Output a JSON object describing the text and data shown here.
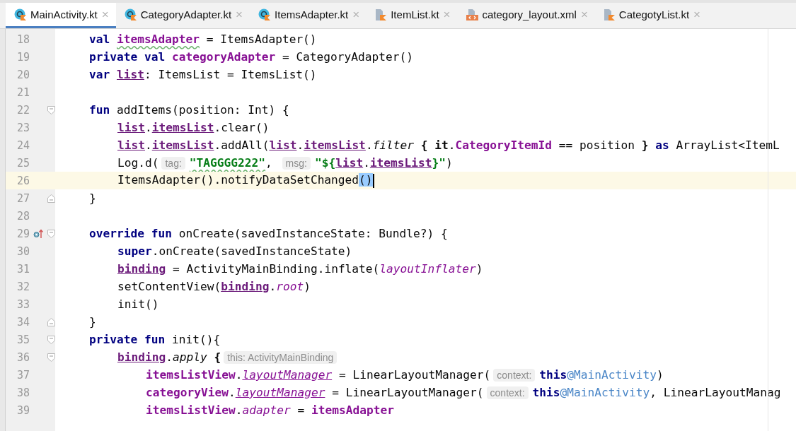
{
  "tabs": [
    {
      "label": "MainActivity.kt",
      "kind": "class",
      "selected": true
    },
    {
      "label": "CategoryAdapter.kt",
      "kind": "class",
      "selected": false
    },
    {
      "label": "ItemsAdapter.kt",
      "kind": "class",
      "selected": false
    },
    {
      "label": "ItemList.kt",
      "kind": "file",
      "selected": false
    },
    {
      "label": "category_layout.xml",
      "kind": "xml",
      "selected": false
    },
    {
      "label": "CategotyList.kt",
      "kind": "file",
      "selected": false
    }
  ],
  "close_glyph": "×",
  "editor": {
    "lines": [
      {
        "number": "18",
        "current": false,
        "tokens": [
          {
            "text": "val ",
            "kind": "kw"
          },
          {
            "text": "itemsAdapter",
            "kind": "field",
            "typo": true
          },
          {
            "text": " = ItemsAdapter()",
            "kind": "plain"
          }
        ]
      },
      {
        "number": "19",
        "current": false,
        "tokens": [
          {
            "text": "private val ",
            "kind": "kw"
          },
          {
            "text": "categoryAdapter",
            "kind": "field"
          },
          {
            "text": " = CategoryAdapter()",
            "kind": "plain"
          }
        ]
      },
      {
        "number": "20",
        "current": false,
        "tokens": [
          {
            "text": "var ",
            "kind": "kw"
          },
          {
            "text": "list",
            "kind": "field_ul"
          },
          {
            "text": ": ItemsList = ItemsList()",
            "kind": "plain"
          }
        ]
      },
      {
        "number": "21",
        "current": false
      },
      {
        "number": "22",
        "current": false,
        "fold_start": true,
        "tokens": [
          {
            "text": "fun ",
            "kind": "kw"
          },
          {
            "text": "addItems(position: Int) {",
            "kind": "plain"
          }
        ],
        "children": [
          {
            "number": "23",
            "current": false,
            "tokens": [
              {
                "text": "list",
                "kind": "field_ul"
              },
              {
                "text": ".",
                "kind": "plain"
              },
              {
                "text": "itemsList",
                "kind": "field_ul"
              },
              {
                "text": ".clear()",
                "kind": "plain"
              }
            ]
          },
          {
            "number": "24",
            "current": false,
            "tokens": [
              {
                "text": "list",
                "kind": "field_ul"
              },
              {
                "text": ".",
                "kind": "plain"
              },
              {
                "text": "itemsList",
                "kind": "field_ul"
              },
              {
                "text": ".addAll(",
                "kind": "plain"
              },
              {
                "text": "list",
                "kind": "field_ul"
              },
              {
                "text": ".",
                "kind": "plain"
              },
              {
                "text": "itemsList",
                "kind": "field_ul"
              },
              {
                "text": ".",
                "kind": "plain"
              },
              {
                "text": "filter",
                "kind": "fn_i"
              },
              {
                "text": " {",
                "kind": "bold"
              },
              {
                "text": " it",
                "kind": "bold"
              },
              {
                "text": ".",
                "kind": "plain"
              },
              {
                "text": "CategoryItemId",
                "kind": "field"
              },
              {
                "text": " == position ",
                "kind": "plain"
              },
              {
                "text": "}",
                "kind": "bold"
              },
              {
                "text": " as",
                "kind": "kw"
              },
              {
                "text": " ArrayList<ItemL",
                "kind": "plain"
              }
            ]
          },
          {
            "number": "25",
            "current": false,
            "tokens": [
              {
                "text": "Log.d(",
                "kind": "plain"
              },
              {
                "text": "tag:",
                "kind": "hint"
              },
              {
                "text": "\"TAGGGG222\"",
                "kind": "str",
                "typo": true
              },
              {
                "text": ", ",
                "kind": "plain"
              },
              {
                "text": "msg:",
                "kind": "hint"
              },
              {
                "text": "\"${",
                "kind": "str"
              },
              {
                "text": "list",
                "kind": "field_ul"
              },
              {
                "text": ".",
                "kind": "plain"
              },
              {
                "text": "itemsList",
                "kind": "field_ul"
              },
              {
                "text": "}\"",
                "kind": "str"
              },
              {
                "text": ")",
                "kind": "plain"
              }
            ]
          },
          {
            "number": "26",
            "current": true,
            "tokens": [
              {
                "text": "ItemsAdapter().notifyDataSetChanged",
                "kind": "plain"
              },
              {
                "text": "()",
                "kind": "match"
              }
            ]
          }
        ]
      },
      {
        "number": "27",
        "current": false,
        "fold_end": true,
        "tokens": [
          {
            "text": "}",
            "kind": "plain"
          }
        ]
      },
      {
        "number": "28",
        "current": false
      },
      {
        "number": "29",
        "current": false,
        "fold_start": true,
        "override": true,
        "tokens": [
          {
            "text": "override fun ",
            "kind": "kw"
          },
          {
            "text": "onCreate(savedInstanceState: Bundle?) {",
            "kind": "plain"
          }
        ],
        "children": [
          {
            "number": "30",
            "current": false,
            "tokens": [
              {
                "text": "super",
                "kind": "kw"
              },
              {
                "text": ".onCreate(savedInstanceState)",
                "kind": "plain"
              }
            ]
          },
          {
            "number": "31",
            "current": false,
            "tokens": [
              {
                "text": "binding",
                "kind": "field_ul"
              },
              {
                "text": " = ActivityMainBinding.inflate(",
                "kind": "plain"
              },
              {
                "text": "layoutInflater",
                "kind": "prop_i"
              },
              {
                "text": ")",
                "kind": "plain"
              }
            ]
          },
          {
            "number": "32",
            "current": false,
            "tokens": [
              {
                "text": "setContentView(",
                "kind": "plain"
              },
              {
                "text": "binding",
                "kind": "field_ul"
              },
              {
                "text": ".",
                "kind": "plain"
              },
              {
                "text": "root",
                "kind": "prop_i"
              },
              {
                "text": ")",
                "kind": "plain"
              }
            ]
          },
          {
            "number": "33",
            "current": false,
            "tokens": [
              {
                "text": "init()",
                "kind": "plain"
              }
            ]
          }
        ]
      },
      {
        "number": "34",
        "current": false,
        "fold_end": true,
        "tokens": [
          {
            "text": "}",
            "kind": "plain"
          }
        ]
      },
      {
        "number": "35",
        "current": false,
        "fold_start": true,
        "tokens": [
          {
            "text": "private fun ",
            "kind": "kw"
          },
          {
            "text": "init(){",
            "kind": "plain"
          }
        ],
        "children": [
          {
            "number": "36",
            "current": false,
            "fold_start": true,
            "tokens": [
              {
                "text": "binding",
                "kind": "field_ul"
              },
              {
                "text": ".",
                "kind": "plain"
              },
              {
                "text": "apply",
                "kind": "fn_i"
              },
              {
                "text": " {",
                "kind": "bold"
              },
              {
                "text": "this: ActivityMainBinding",
                "kind": "hint"
              }
            ],
            "children": [
              {
                "number": "37",
                "current": false,
                "tokens": [
                  {
                    "text": "itemsListView",
                    "kind": "field"
                  },
                  {
                    "text": ".",
                    "kind": "plain"
                  },
                  {
                    "text": "layoutManager",
                    "kind": "prop_i_ul"
                  },
                  {
                    "text": " = LinearLayoutManager(",
                    "kind": "plain"
                  },
                  {
                    "text": "context:",
                    "kind": "hint"
                  },
                  {
                    "text": "this",
                    "kind": "kw"
                  },
                  {
                    "text": "@MainActivity",
                    "kind": "label"
                  },
                  {
                    "text": ")",
                    "kind": "plain"
                  }
                ]
              },
              {
                "number": "38",
                "current": false,
                "tokens": [
                  {
                    "text": "categoryView",
                    "kind": "field"
                  },
                  {
                    "text": ".",
                    "kind": "plain"
                  },
                  {
                    "text": "layoutManager",
                    "kind": "prop_i_ul"
                  },
                  {
                    "text": " = LinearLayoutManager(",
                    "kind": "plain"
                  },
                  {
                    "text": "context:",
                    "kind": "hint"
                  },
                  {
                    "text": "this",
                    "kind": "kw"
                  },
                  {
                    "text": "@MainActivity",
                    "kind": "label"
                  },
                  {
                    "text": ", LinearLayoutManag",
                    "kind": "plain"
                  }
                ]
              },
              {
                "number": "39",
                "current": false,
                "tokens": [
                  {
                    "text": "itemsListView",
                    "kind": "field"
                  },
                  {
                    "text": ".",
                    "kind": "plain"
                  },
                  {
                    "text": "adapter",
                    "kind": "prop_i"
                  },
                  {
                    "text": " = ",
                    "kind": "plain"
                  },
                  {
                    "text": "itemsAdapter",
                    "kind": "field"
                  }
                ]
              }
            ]
          }
        ]
      }
    ]
  }
}
